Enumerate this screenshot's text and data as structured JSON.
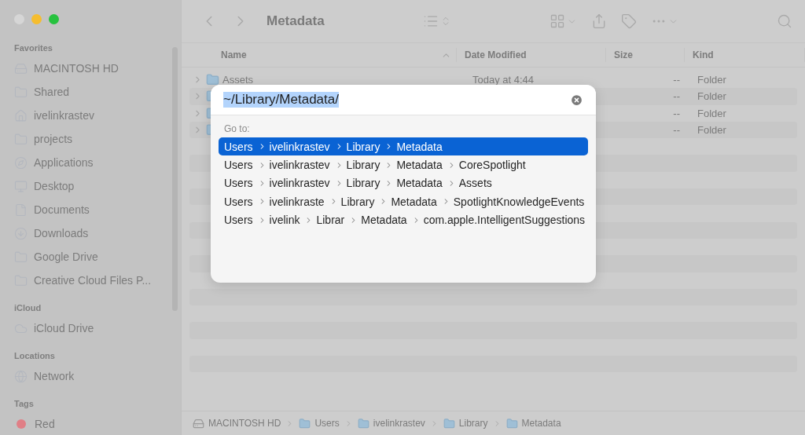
{
  "window": {
    "title": "Metadata"
  },
  "sidebar": {
    "sections": [
      {
        "heading": "Favorites",
        "items": [
          {
            "label": "MACINTOSH HD",
            "kind": "drive"
          },
          {
            "label": "Shared",
            "kind": "folder"
          },
          {
            "label": "ivelinkrastev",
            "kind": "home"
          },
          {
            "label": "projects",
            "kind": "folder"
          },
          {
            "label": "Applications",
            "kind": "apps"
          },
          {
            "label": "Desktop",
            "kind": "desktop"
          },
          {
            "label": "Documents",
            "kind": "document"
          },
          {
            "label": "Downloads",
            "kind": "download"
          },
          {
            "label": "Google Drive",
            "kind": "folder"
          },
          {
            "label": "Creative Cloud Files P...",
            "kind": "folder"
          }
        ]
      },
      {
        "heading": "iCloud",
        "items": [
          {
            "label": "iCloud Drive",
            "kind": "cloud"
          }
        ]
      },
      {
        "heading": "Locations",
        "items": [
          {
            "label": "Network",
            "kind": "network"
          }
        ]
      },
      {
        "heading": "Tags",
        "items": [
          {
            "label": "Red",
            "kind": "tag",
            "color": "#e07f86"
          }
        ]
      }
    ]
  },
  "table": {
    "columns": [
      "Name",
      "Date Modified",
      "Size",
      "Kind"
    ],
    "rows": [
      {
        "name": "Assets",
        "date": "Today at 4:44",
        "size": "--",
        "kind": "Folder"
      },
      {
        "name": "",
        "date": "",
        "size": "--",
        "kind": "Folder"
      },
      {
        "name": "",
        "date": "",
        "size": "--",
        "kind": "Folder"
      },
      {
        "name": "",
        "date": "",
        "size": "--",
        "kind": "Folder"
      }
    ]
  },
  "dialog": {
    "path": "~/Library/Metadata/",
    "heading": "Go to:",
    "suggestions": [
      {
        "selected": true,
        "segments": [
          "Users",
          "ivelinkrastev",
          "Library",
          "Metadata"
        ]
      },
      {
        "selected": false,
        "segments": [
          "Users",
          "ivelinkrastev",
          "Library",
          "Metadata",
          "CoreSpotlight"
        ]
      },
      {
        "selected": false,
        "segments": [
          "Users",
          "ivelinkrastev",
          "Library",
          "Metadata",
          "Assets"
        ]
      },
      {
        "selected": false,
        "segments": [
          "Users",
          "ivelinkraste",
          "Library",
          "Metadata",
          "SpotlightKnowledgeEvents"
        ]
      },
      {
        "selected": false,
        "segments": [
          "Users",
          "ivelink",
          "Librar",
          "Metadata",
          "com.apple.IntelligentSuggestions"
        ]
      }
    ]
  },
  "path_bar": [
    {
      "label": "MACINTOSH HD",
      "kind": "drive"
    },
    {
      "label": "Users",
      "kind": "folder"
    },
    {
      "label": "ivelinkrastev",
      "kind": "folder"
    },
    {
      "label": "Library",
      "kind": "folder"
    },
    {
      "label": "Metadata",
      "kind": "folder"
    }
  ]
}
